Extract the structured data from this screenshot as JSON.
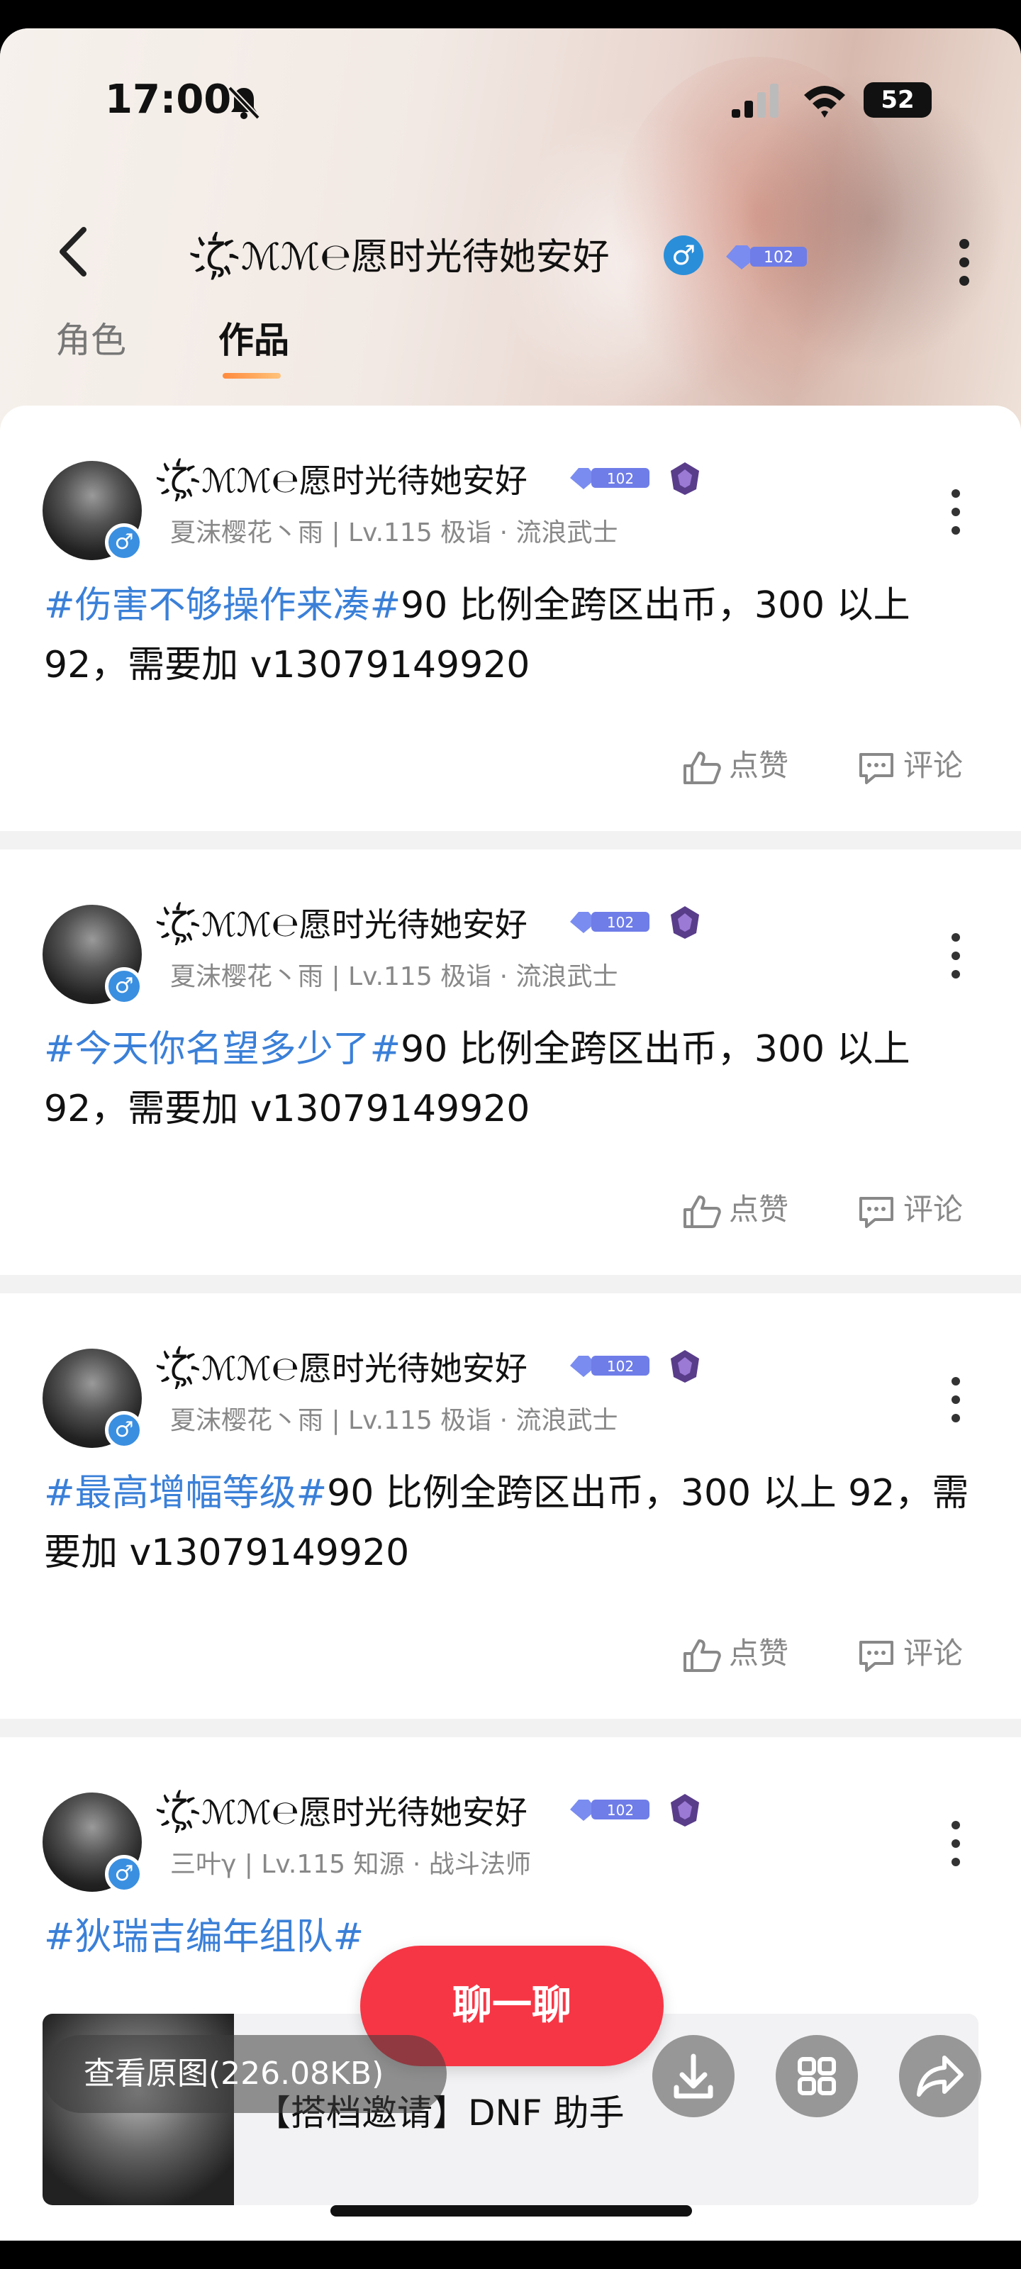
{
  "status_bar": {
    "time": "17:00",
    "battery": "52"
  },
  "header": {
    "title": "ζ҉ℳℳ℮愿时光待她安好",
    "gender_symbol": "♂",
    "level_badge": "102"
  },
  "tabs": [
    {
      "label": "角色"
    },
    {
      "label": "作品"
    }
  ],
  "posts": [
    {
      "author": "ζ҉ℳℳ℮愿时光待她安好",
      "meta": "夏沫樱花丶雨 | Lv.115 极诣 · 流浪武士",
      "tag": "#伤害不够操作来凑#",
      "body": "90 比例全跨区出币，300 以上 92，需要加 v13079149920",
      "like_label": "点赞",
      "comment_label": "评论"
    },
    {
      "author": "ζ҉ℳℳ℮愿时光待她安好",
      "meta": "夏沫樱花丶雨 | Lv.115 极诣 · 流浪武士",
      "tag": "#今天你名望多少了#",
      "body": "90 比例全跨区出币，300 以上 92，需要加 v13079149920",
      "like_label": "点赞",
      "comment_label": "评论"
    },
    {
      "author": "ζ҉ℳℳ℮愿时光待她安好",
      "meta": "夏沫樱花丶雨 | Lv.115 极诣 · 流浪武士",
      "tag": "#最高增幅等级#",
      "body": "90 比例全跨区出币，300 以上 92，需要加 v13079149920",
      "like_label": "点赞",
      "comment_label": "评论"
    },
    {
      "author": "ζ҉ℳℳ℮愿时光待她安好",
      "meta": "三叶γ | Lv.115 知源 · 战斗法师",
      "tag": "#狄瑞吉编年组队#",
      "preview_title": "【搭档邀请】DNF 助手"
    }
  ],
  "chat_button": "聊一聊",
  "image_viewer": {
    "view_original": "查看原图(226.08KB)"
  },
  "colors": {
    "accent_red": "#f73645",
    "tag_blue": "#3a7fd8",
    "gender_blue": "#2a8fd8"
  },
  "icons": [
    "back-icon",
    "more-icon",
    "like-icon",
    "comment-icon",
    "download-icon",
    "grid-icon",
    "share-icon",
    "bell-off-icon",
    "signal-icon",
    "wifi-icon"
  ]
}
